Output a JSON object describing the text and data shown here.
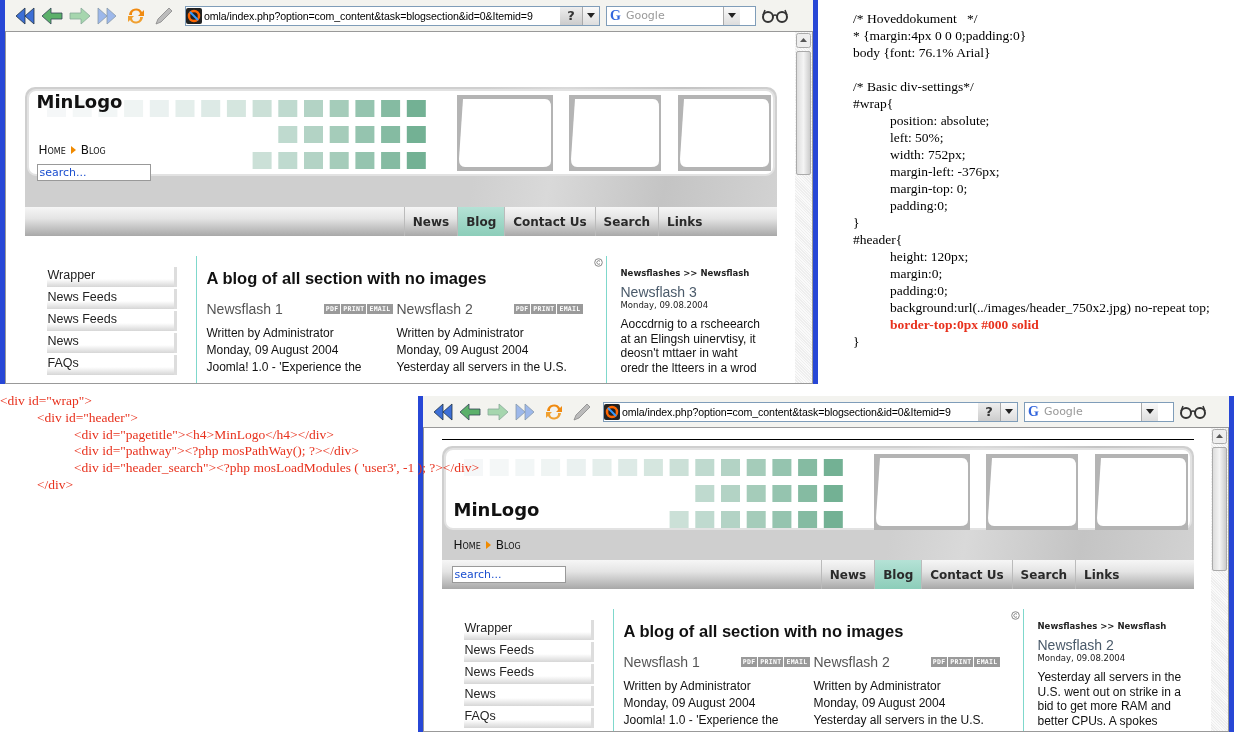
{
  "browsers": [
    {
      "kind": "search-in-header",
      "top_border": false,
      "url": "omla/index.php?option=com_content&task=blogsection&id=0&Itemid=9",
      "help_button": "?",
      "engine_letter": "G",
      "search_placeholder": "Google",
      "logo": "MinLogo",
      "pathway": [
        "Home",
        "Blog"
      ],
      "search_value": "search...",
      "nav": [
        {
          "label": "News",
          "selected": false
        },
        {
          "label": "Blog",
          "selected": true
        },
        {
          "label": "Contact Us",
          "selected": false
        },
        {
          "label": "Search",
          "selected": false
        },
        {
          "label": "Links",
          "selected": false
        }
      ],
      "menu": [
        "Wrapper",
        "News Feeds",
        "News Feeds",
        "News",
        "FAQs"
      ],
      "title": "A blog of all section with no images",
      "articles": [
        {
          "title": "Newsflash 1",
          "badges": [
            "PDF",
            "PRINT",
            "EMAIL"
          ],
          "author": "Written by Administrator",
          "date": "Monday, 09 August 2004",
          "intro": "Joomla! 1.0 - 'Experience the"
        },
        {
          "title": "Newsflash 2",
          "badges": [
            "PDF",
            "PRINT",
            "EMAIL"
          ],
          "author": "Written by Administrator",
          "date": "Monday, 09 August 2004",
          "intro": "Yesterday all servers in the U.S."
        }
      ],
      "side": {
        "heading": "Newsflashes >> Newsflash",
        "title": "Newsflash 3",
        "date": "Monday, 09.08.2004",
        "lines": [
          "Aoccdrnig to a rscheearch",
          "at an Elingsh uinervtisy, it",
          "deosn't mttaer in waht",
          "oredr the ltteers in a wrod"
        ]
      }
    },
    {
      "kind": "search-in-nav",
      "top_border": true,
      "url": "omla/index.php?option=com_content&task=blogsection&id=0&Itemid=9",
      "help_button": "?",
      "engine_letter": "G",
      "search_placeholder": "Google",
      "logo": "MinLogo",
      "pathway": [
        "Home",
        "Blog"
      ],
      "search_value": "search...",
      "nav": [
        {
          "label": "News",
          "selected": false
        },
        {
          "label": "Blog",
          "selected": true
        },
        {
          "label": "Contact Us",
          "selected": false
        },
        {
          "label": "Search",
          "selected": false
        },
        {
          "label": "Links",
          "selected": false
        }
      ],
      "menu": [
        "Wrapper",
        "News Feeds",
        "News Feeds",
        "News",
        "FAQs"
      ],
      "title": "A blog of all section with no images",
      "articles": [
        {
          "title": "Newsflash 1",
          "badges": [
            "PDF",
            "PRINT",
            "EMAIL"
          ],
          "author": "Written by Administrator",
          "date": "Monday, 09 August 2004",
          "intro": "Joomla! 1.0 - 'Experience the"
        },
        {
          "title": "Newsflash 2",
          "badges": [
            "PDF",
            "PRINT",
            "EMAIL"
          ],
          "author": "Written by Administrator",
          "date": "Monday, 09 August 2004",
          "intro": "Yesterday all servers in the U.S."
        }
      ],
      "side": {
        "heading": "Newsflashes >> Newsflash",
        "title": "Newsflash 2",
        "date": "Monday, 09.08.2004",
        "lines": [
          "Yesterday all servers in the",
          "U.S. went out on strike in a",
          "bid to get more RAM and",
          "better CPUs. A spokes"
        ]
      }
    }
  ],
  "css_code": {
    "sections": [
      {
        "lines": [
          {
            "text": "/* Hoveddokument   */",
            "highlight": false
          },
          {
            "text": "* {margin:4px 0 0 0;padding:0}",
            "highlight": false
          },
          {
            "text": "body {font: 76.1% Arial}",
            "highlight": false
          }
        ]
      },
      {
        "lines": [
          {
            "text": "/* Basic div-settings*/",
            "highlight": false
          },
          {
            "text": "#wrap{",
            "highlight": false,
            "children": [
              {
                "text": "position: absolute;",
                "highlight": false
              },
              {
                "text": "left: 50%;",
                "highlight": false
              },
              {
                "text": "width: 752px;",
                "highlight": false
              },
              {
                "text": "margin-left: -376px;",
                "highlight": false
              },
              {
                "text": "margin-top: 0;",
                "highlight": false
              },
              {
                "text": "padding:0;",
                "highlight": false
              }
            ]
          },
          {
            "text": "}",
            "highlight": false
          },
          {
            "text": "#header{",
            "highlight": false,
            "children": [
              {
                "text": "height: 120px;",
                "highlight": false
              },
              {
                "text": "margin:0;",
                "highlight": false
              },
              {
                "text": "padding:0;",
                "highlight": false
              },
              {
                "text": "background:url(../images/header_750x2.jpg) no-repeat top;",
                "highlight": false
              },
              {
                "text": "border-top:0px #000 solid",
                "highlight": true
              }
            ]
          },
          {
            "text": "}",
            "highlight": false
          }
        ]
      }
    ]
  },
  "html_code": {
    "lines": [
      {
        "text": "<div id=\"wrap\">",
        "children": [
          {
            "text": "<div id=\"header\">",
            "children": [
              {
                "text": "<div id=\"pagetitle\"><h4>MinLogo</h4></div>"
              },
              {
                "text": "<div id=\"pathway\"><?php mosPathWay(); ?></div>"
              },
              {
                "text": "<div id=\"header_search\"><?php mosLoadModules ( 'user3', -1 ); ?></div>"
              }
            ]
          },
          {
            "text": "</div>"
          }
        ]
      }
    ]
  }
}
